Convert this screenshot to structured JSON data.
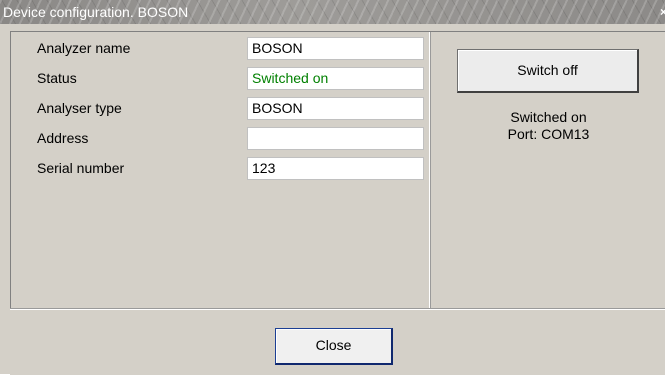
{
  "window": {
    "title": "Device configuration. BOSON",
    "close_glyph": "×"
  },
  "fields": [
    {
      "label": "Analyzer name",
      "value": "BOSON"
    },
    {
      "label": "Status",
      "value": "Switched on"
    },
    {
      "label": "Analyser type",
      "value": "BOSON"
    },
    {
      "label": "Address",
      "value": ""
    },
    {
      "label": "Serial number",
      "value": "123"
    }
  ],
  "colors": {
    "status_value": "#008000",
    "dialog_bg": "#d4d0c8"
  },
  "right_panel": {
    "switch_button_label": "Switch off",
    "state_text": "Switched on",
    "port_text": "Port: COM13"
  },
  "footer": {
    "close_button_label": "Close"
  }
}
